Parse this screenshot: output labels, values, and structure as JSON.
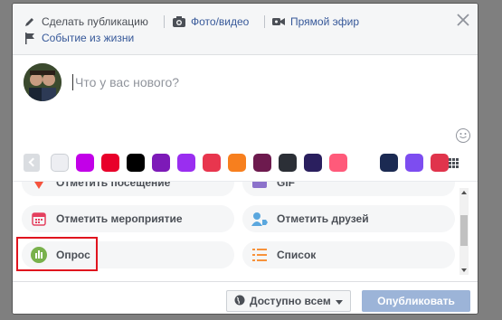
{
  "tabs": {
    "make_post": "Сделать публикацию",
    "photo_video": "Фото/видео",
    "live": "Прямой эфир",
    "life_event": "Событие из жизни"
  },
  "composer": {
    "placeholder": "Что у вас нового?"
  },
  "backgrounds": [
    "#edeef2",
    "#c200e8",
    "#e8002a",
    "#000000",
    "#7d1ab8",
    "#9a2ef0",
    "#e8364e",
    "#f77f1e",
    "#6d1a4e",
    "#2b2f36",
    "#2a1f5e",
    "#ff5a7a",
    "#ffffff",
    "#1b2a52",
    "#7d4df0",
    "#e0344c"
  ],
  "options": {
    "checkin": "Отметить посещение",
    "gif": "GIF",
    "event": "Отметить мероприятие",
    "tag_friends": "Отметить друзей",
    "poll": "Опрос",
    "list": "Список"
  },
  "footer": {
    "audience": "Доступно всем",
    "publish": "Опубликовать"
  },
  "colors": {
    "link": "#365899",
    "highlight": "#e0141e",
    "publish": "#9cb4d8"
  }
}
